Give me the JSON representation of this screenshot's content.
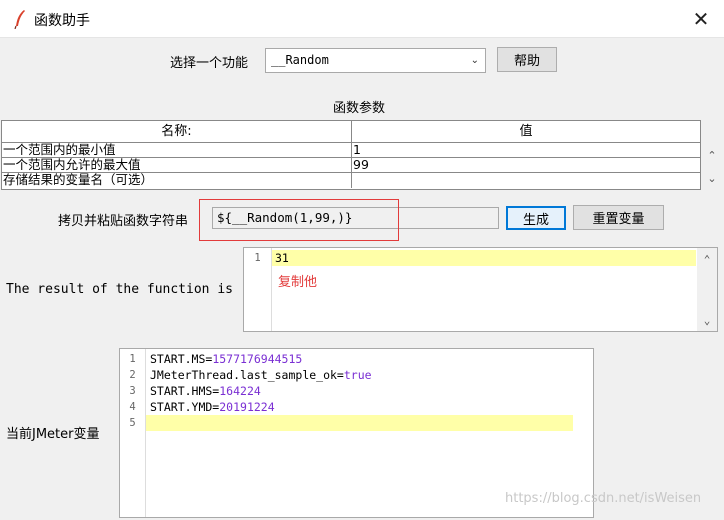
{
  "window": {
    "title": "函数助手",
    "close_glyph": "✕"
  },
  "function_select": {
    "label": "选择一个功能",
    "value": "__Random",
    "help_button": "帮助"
  },
  "params": {
    "section_title": "函数参数",
    "columns": [
      "名称:",
      "值"
    ],
    "rows": [
      {
        "name": "一个范围内的最小值",
        "value": "1"
      },
      {
        "name": "一个范围内允许的最大值",
        "value": "99"
      },
      {
        "name": "存储结果的变量名（可选）",
        "value": ""
      }
    ]
  },
  "function_string": {
    "label": "拷贝并粘贴函数字符串",
    "value": "${__Random(1,99,)}",
    "generate_button": "生成",
    "reset_button": "重置变量"
  },
  "result": {
    "label": "The result of the function is",
    "line_numbers": [
      "1"
    ],
    "lines": [
      "31"
    ],
    "note": "复制他"
  },
  "jmeter_vars": {
    "label": "当前JMeter变量",
    "line_numbers": [
      "1",
      "2",
      "3",
      "4",
      "5"
    ],
    "lines": [
      {
        "key": "START.MS=",
        "val": "1577176944515"
      },
      {
        "key": "JMeterThread.last_sample_ok=",
        "val": "true"
      },
      {
        "key": "START.HMS=",
        "val": "164224"
      },
      {
        "key": "START.YMD=",
        "val": "20191224"
      },
      {
        "key": "",
        "val": ""
      }
    ]
  },
  "watermark": "https://blog.csdn.net/isWeisen",
  "colors": {
    "accent": "#0078d7",
    "annotation": "#e23b3b",
    "value_purple": "#7a2fd3",
    "highlight_line": "#ffffa8"
  }
}
